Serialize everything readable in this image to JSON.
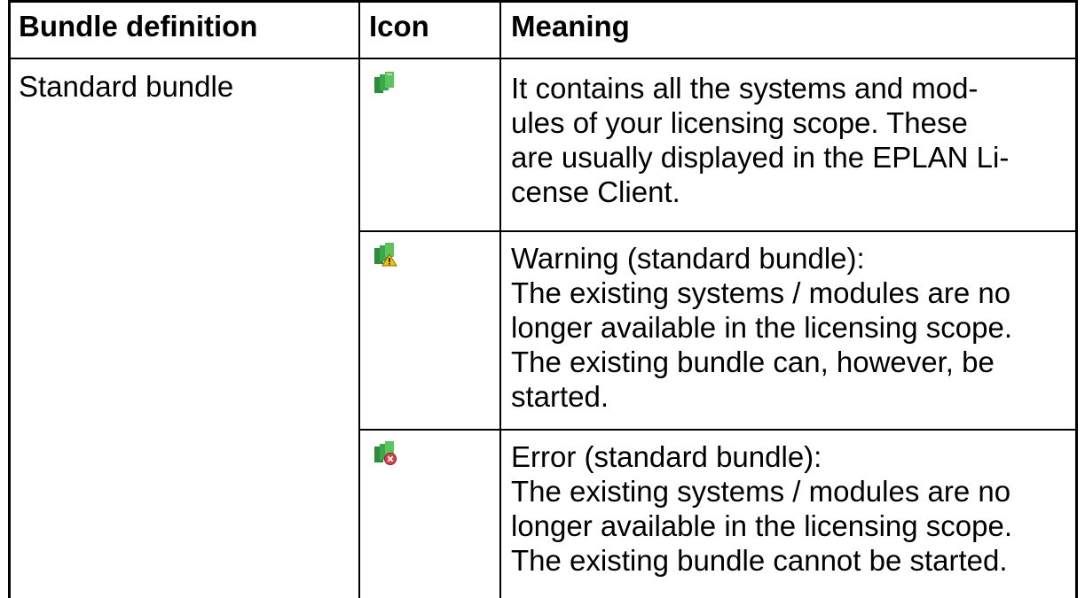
{
  "table": {
    "headers": {
      "definition": "Bundle definition",
      "icon": "Icon",
      "meaning": "Meaning"
    },
    "definition_cell": "Standard bundle",
    "rows": [
      {
        "icon": "standard-bundle-icon",
        "meaning_lines": [
          "It contains all the systems and mod-",
          "ules of your licensing scope. These",
          "are usually displayed in the EPLAN Li-",
          "cense Client."
        ]
      },
      {
        "icon": "standard-bundle-warning-icon",
        "meaning_lines": [
          "Warning (standard bundle):",
          "The existing systems / modules are no",
          "longer available in the licensing scope.",
          "The existing bundle can, however, be",
          "started."
        ]
      },
      {
        "icon": "standard-bundle-error-icon",
        "meaning_lines": [
          "Error (standard bundle):",
          "The existing systems / modules are no",
          "longer available in the licensing scope.",
          "The existing bundle cannot be started."
        ]
      }
    ]
  },
  "colors": {
    "icon_green": "#3aa84a",
    "warning_yellow": "#f2c200",
    "error_red": "#e0404a"
  }
}
